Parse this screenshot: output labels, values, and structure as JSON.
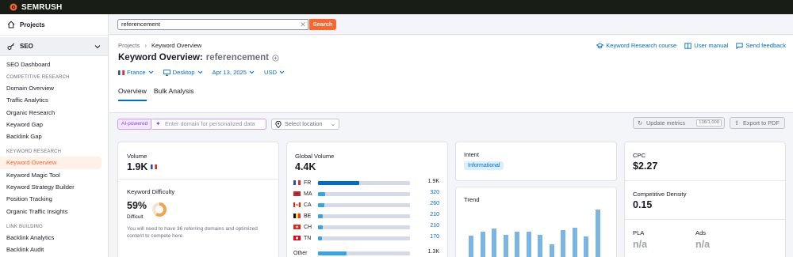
{
  "app": {
    "brand": "SEMRUSH"
  },
  "sidebar": {
    "projects": "Projects",
    "seo": "SEO",
    "dashboard": "SEO Dashboard",
    "sections": [
      {
        "title": "COMPETITIVE RESEARCH",
        "items": [
          "Domain Overview",
          "Traffic Analytics",
          "Organic Research",
          "Keyword Gap",
          "Backlink Gap"
        ]
      },
      {
        "title": "KEYWORD RESEARCH",
        "items": [
          "Keyword Overview",
          "Keyword Magic Tool",
          "Keyword Strategy Builder",
          "Position Tracking",
          "Organic Traffic Insights"
        ]
      },
      {
        "title": "LINK BUILDING",
        "items": [
          "Backlink Analytics",
          "Backlink Audit"
        ]
      }
    ],
    "active": "Keyword Overview"
  },
  "search": {
    "value": "referencement",
    "button": "Search"
  },
  "breadcrumb": [
    "Projects",
    "Keyword Overview"
  ],
  "top_links": [
    "Keyword Research course",
    "User manual",
    "Send feedback"
  ],
  "title": {
    "prefix": "Keyword Overview:",
    "keyword": "referencement"
  },
  "filters": [
    "France",
    "Desktop",
    "Apr 13, 2025",
    "USD"
  ],
  "tabs": [
    "Overview",
    "Bulk Analysis"
  ],
  "actions": {
    "ai_badge": "AI-powered",
    "ai_placeholder": "Enter domain for personalized data",
    "location_placeholder": "Select location",
    "update": "Update metrics",
    "update_count": "138/1,000",
    "export": "Export to PDF"
  },
  "volume": {
    "label": "Volume",
    "value": "1.9K"
  },
  "kd": {
    "label": "Keyword Difficulty",
    "value": "59%",
    "level": "Difficult",
    "percent": 59,
    "note": "You will need to have 36 referring domains and optimized content to compete here.",
    "color": "#f0a44e"
  },
  "global": {
    "label": "Global Volume",
    "value": "4.4K",
    "rows": [
      {
        "code": "FR",
        "value": "1.9K",
        "share": 0.45
      },
      {
        "code": "MA",
        "value": "320",
        "share": 0.08
      },
      {
        "code": "CA",
        "value": "260",
        "share": 0.07
      },
      {
        "code": "BE",
        "value": "210",
        "share": 0.055
      },
      {
        "code": "CH",
        "value": "210",
        "share": 0.055
      },
      {
        "code": "TN",
        "value": "170",
        "share": 0.045
      },
      {
        "code": "Other",
        "value": "1.3K",
        "share": 0.31
      }
    ]
  },
  "intent": {
    "label": "Intent",
    "badge": "Informational"
  },
  "trend": {
    "label": "Trend",
    "values": [
      45,
      54,
      60,
      46,
      54,
      54,
      46,
      27,
      56,
      62,
      43,
      100
    ]
  },
  "cpc": {
    "label": "CPC",
    "value": "$2.27"
  },
  "density": {
    "label": "Competitive Density",
    "value": "0.15"
  },
  "pla": {
    "label": "PLA",
    "value": "n/a"
  },
  "ads": {
    "label": "Ads",
    "value": "n/a"
  }
}
